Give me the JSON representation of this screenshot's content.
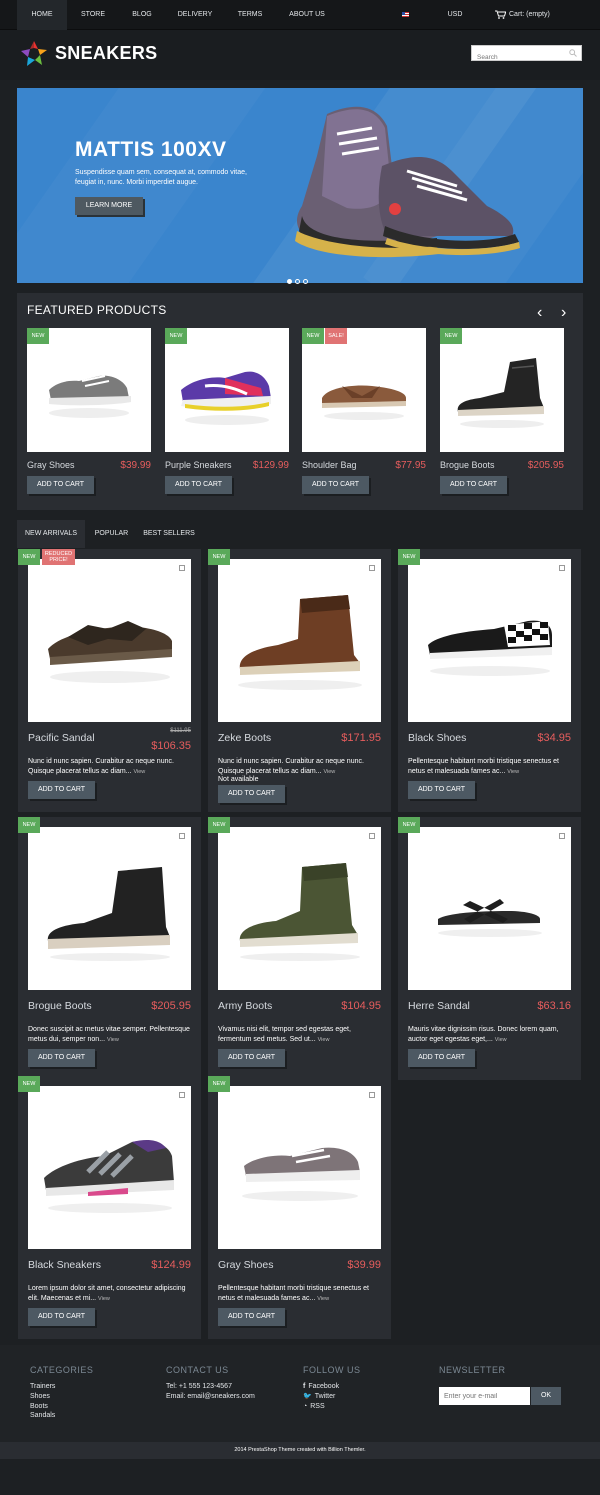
{
  "nav": {
    "items": [
      "HOME",
      "STORE",
      "BLOG",
      "DELIVERY",
      "TERMS",
      "ABOUT US"
    ],
    "currency": "USD",
    "cart": "Cart: (empty)"
  },
  "header": {
    "logo": "SNEAKERS",
    "search_placeholder": "Search"
  },
  "banner": {
    "title": "MATTIS 100XV",
    "text": "Suspendisse quam sem, consequat at, commodo vitae, feugiat in, nunc. Morbi imperdiet augue.",
    "button": "LEARN MORE",
    "slides": 3,
    "active_slide": 1
  },
  "featured": {
    "title": "FEATURED PRODUCTS",
    "prev": "‹",
    "next": "›",
    "products": [
      {
        "name": "Gray Shoes",
        "price": "$39.99",
        "badges": [
          "NEW"
        ],
        "cart": "ADD TO CART"
      },
      {
        "name": "Purple Sneakers",
        "price": "$129.99",
        "badges": [
          "NEW"
        ],
        "cart": "ADD TO CART"
      },
      {
        "name": "Shoulder Bag",
        "price": "$77.95",
        "badges": [
          "NEW",
          "SALE!"
        ],
        "cart": "ADD TO CART"
      },
      {
        "name": "Brogue Boots",
        "price": "$205.95",
        "badges": [
          "NEW"
        ],
        "cart": "ADD TO CART"
      }
    ]
  },
  "tabs": [
    "NEW ARRIVALS",
    "POPULAR",
    "BEST SELLERS"
  ],
  "products": [
    {
      "name": "Pacific Sandal",
      "price": "$106.35",
      "old_price": "$111.95",
      "badge": "NEW",
      "badge2": "REDUCED PRICE!",
      "desc": "Nunc id nunc sapien. Curabitur ac neque nunc. Quisque placerat tellus ac diam...",
      "view": "View",
      "cart": "ADD TO CART"
    },
    {
      "name": "Zeke Boots",
      "price": "$171.95",
      "badge": "NEW",
      "desc": "Nunc id nunc sapien. Curabitur ac neque nunc. Quisque placerat tellus ac diam...",
      "view": "View",
      "availability": "Not available",
      "cart": "ADD TO CART"
    },
    {
      "name": "Black Shoes",
      "price": "$34.95",
      "badge": "NEW",
      "desc": "Pellentesque habitant morbi tristique senectus et netus et malesuada fames ac...",
      "view": "View",
      "cart": "ADD TO CART"
    },
    {
      "name": "Brogue Boots",
      "price": "$205.95",
      "badge": "NEW",
      "desc": "Donec suscipit ac metus vitae semper. Pellentesque metus dui, semper non...",
      "view": "View",
      "cart": "ADD TO CART"
    },
    {
      "name": "Army Boots",
      "price": "$104.95",
      "badge": "NEW",
      "desc": "Vivamus nisi elit, tempor sed egestas eget, fermentum sed metus. Sed ut...",
      "view": "View",
      "cart": "ADD TO CART"
    },
    {
      "name": "Herre Sandal",
      "price": "$63.16",
      "badge": "NEW",
      "desc": "Mauris vitae dignissim risus. Donec lorem quam, auctor eget egestas eget,...",
      "view": "View",
      "cart": "ADD TO CART"
    },
    {
      "name": "Black Sneakers",
      "price": "$124.99",
      "badge": "NEW",
      "desc": "Lorem ipsum dolor sit amet, consectetur adipiscing elit. Maecenas et mi...",
      "view": "View",
      "cart": "ADD TO CART"
    },
    {
      "name": "Gray Shoes",
      "price": "$39.99",
      "badge": "NEW",
      "desc": "Pellentesque habitant morbi tristique senectus et netus et malesuada fames ac...",
      "view": "View",
      "cart": "ADD TO CART"
    }
  ],
  "footer": {
    "categories": {
      "title": "CATEGORIES",
      "items": [
        "Trainers",
        "Shoes",
        "Boots",
        "Sandals"
      ]
    },
    "contact": {
      "title": "CONTACT US",
      "tel": "Tel: +1 555 123-4567",
      "email": "Email: email@sneakers.com"
    },
    "follow": {
      "title": "FOLLOW US",
      "items": [
        "Facebook",
        "Twitter",
        "RSS"
      ]
    },
    "newsletter": {
      "title": "NEWSLETTER",
      "placeholder": "Enter your e-mail",
      "button": "OK"
    },
    "copyright": "2014 PrestaShop Theme created with Billion Themler."
  },
  "colors": {
    "accent": "#3a85cd",
    "price": "#e65d5d",
    "badge_new": "#5aa95a",
    "badge_sale": "#e07373",
    "button": "#4d5963"
  }
}
